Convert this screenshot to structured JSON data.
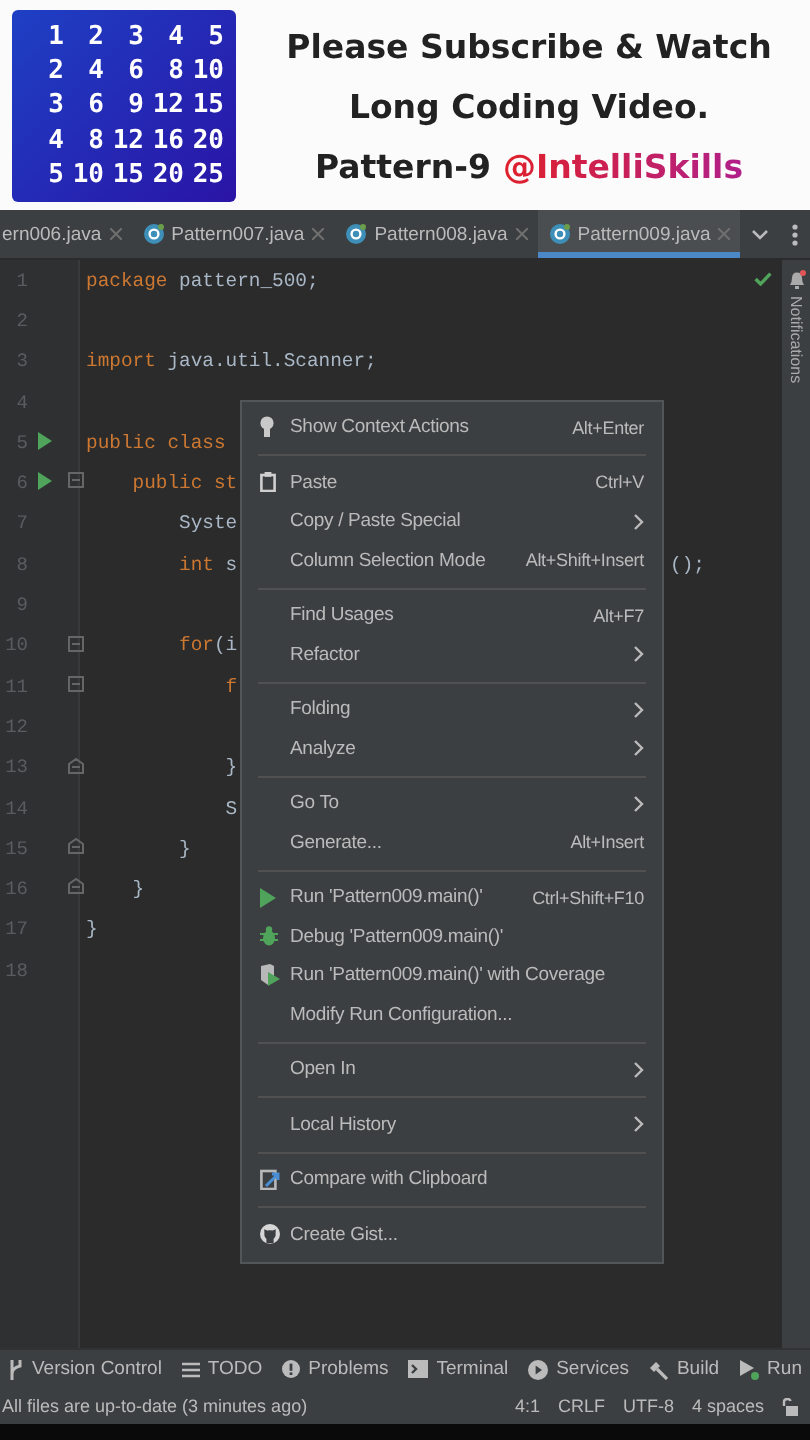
{
  "banner": {
    "number_grid": [
      [
        "1",
        "2",
        "3",
        "4",
        "5"
      ],
      [
        "2",
        "4",
        "6",
        "8",
        "10"
      ],
      [
        "3",
        "6",
        "9",
        "12",
        "15"
      ],
      [
        "4",
        "8",
        "12",
        "16",
        "20"
      ],
      [
        "5",
        "10",
        "15",
        "20",
        "25"
      ]
    ],
    "title_lines": [
      "Please Subscribe & Watch",
      "Long Coding Video."
    ],
    "pattern_label": "Pattern-9",
    "channel": "@IntelliSkills"
  },
  "tabs": [
    {
      "label": "ern006.java",
      "icon": false,
      "selected": false
    },
    {
      "label": "Pattern007.java",
      "icon": true,
      "selected": false
    },
    {
      "label": "Pattern008.java",
      "icon": true,
      "selected": false
    },
    {
      "label": "Pattern009.java",
      "icon": true,
      "selected": true
    }
  ],
  "notifications": {
    "label": "Notifications"
  },
  "code_lines": [
    {
      "number": "1",
      "run": false,
      "fold_start": false,
      "fold_end": false,
      "parts": [
        {
          "text": "package",
          "kind": "keyword"
        },
        {
          "text": " pattern_500;",
          "kind": "plain"
        }
      ]
    },
    {
      "number": "2",
      "run": false,
      "fold_start": false,
      "fold_end": false
    },
    {
      "number": "3",
      "run": false,
      "fold_start": false,
      "fold_end": false,
      "parts": [
        {
          "text": "import",
          "kind": "keyword"
        },
        {
          "text": " java.util.Scanner;",
          "kind": "plain"
        }
      ]
    },
    {
      "number": "4",
      "run": false,
      "fold_start": false,
      "fold_end": false
    },
    {
      "number": "5",
      "run": true,
      "fold_start": false,
      "fold_end": false,
      "parts": [
        {
          "text": "public class",
          "kind": "keyword"
        }
      ]
    },
    {
      "number": "6",
      "run": true,
      "fold_start": true,
      "fold_end": false,
      "parts": [
        {
          "text": "    public st",
          "kind": "keyword"
        }
      ]
    },
    {
      "number": "7",
      "run": false,
      "fold_start": false,
      "fold_end": false,
      "parts": [
        {
          "text": "        Syste",
          "kind": "plain"
        }
      ]
    },
    {
      "number": "8",
      "run": false,
      "fold_start": false,
      "fold_end": false,
      "parts": [
        {
          "text": "        int",
          "kind": "keyword"
        },
        {
          "text": " s",
          "kind": "plain"
        }
      ],
      "tail": "();"
    },
    {
      "number": "9",
      "run": false,
      "fold_start": false,
      "fold_end": false
    },
    {
      "number": "10",
      "run": false,
      "fold_start": true,
      "fold_end": false,
      "parts": [
        {
          "text": "        for",
          "kind": "keyword"
        },
        {
          "text": "(i",
          "kind": "plain"
        }
      ]
    },
    {
      "number": "11",
      "run": false,
      "fold_start": true,
      "fold_end": false,
      "parts": [
        {
          "text": "            f",
          "kind": "keyword"
        }
      ]
    },
    {
      "number": "12",
      "run": false,
      "fold_start": false,
      "fold_end": false
    },
    {
      "number": "13",
      "run": false,
      "fold_start": false,
      "fold_end": true,
      "parts": [
        {
          "text": "            }",
          "kind": "plain"
        }
      ]
    },
    {
      "number": "14",
      "run": false,
      "fold_start": false,
      "fold_end": false,
      "parts": [
        {
          "text": "            S",
          "kind": "plain"
        }
      ]
    },
    {
      "number": "15",
      "run": false,
      "fold_start": false,
      "fold_end": true,
      "parts": [
        {
          "text": "        }",
          "kind": "plain"
        }
      ]
    },
    {
      "number": "16",
      "run": false,
      "fold_start": false,
      "fold_end": true,
      "parts": [
        {
          "text": "    }",
          "kind": "plain"
        }
      ]
    },
    {
      "number": "17",
      "run": false,
      "fold_start": false,
      "fold_end": false,
      "parts": [
        {
          "text": "}",
          "kind": "plain"
        }
      ]
    },
    {
      "number": "18",
      "run": false,
      "fold_start": false,
      "fold_end": false
    }
  ],
  "context_menu": {
    "groups": [
      [
        {
          "label": "Show Context Actions",
          "shortcut": "Alt+Enter",
          "submenu": false
        }
      ],
      [
        {
          "label": "Paste",
          "shortcut": "Ctrl+V",
          "submenu": false
        },
        {
          "label": "Copy / Paste Special",
          "submenu": true
        },
        {
          "label": "Column Selection Mode",
          "shortcut": "Alt+Shift+Insert",
          "submenu": false
        }
      ],
      [
        {
          "label": "Find Usages",
          "shortcut": "Alt+F7",
          "submenu": false
        },
        {
          "label": "Refactor",
          "submenu": true
        }
      ],
      [
        {
          "label": "Folding",
          "submenu": true
        },
        {
          "label": "Analyze",
          "submenu": true
        }
      ],
      [
        {
          "label": "Go To",
          "submenu": true
        },
        {
          "label": "Generate...",
          "shortcut": "Alt+Insert",
          "submenu": false
        }
      ],
      [
        {
          "label": "Run 'Pattern009.main()'",
          "shortcut": "Ctrl+Shift+F10",
          "submenu": false
        },
        {
          "label": "Debug 'Pattern009.main()'",
          "submenu": false
        },
        {
          "label": "Run 'Pattern009.main()' with Coverage",
          "submenu": false
        },
        {
          "label": "Modify Run Configuration...",
          "submenu": false
        }
      ],
      [
        {
          "label": "Open In",
          "submenu": true
        }
      ],
      [
        {
          "label": "Local History",
          "submenu": true
        }
      ],
      [
        {
          "label": "Compare with Clipboard",
          "submenu": false
        }
      ],
      [
        {
          "label": "Create Gist...",
          "submenu": false
        }
      ]
    ]
  },
  "tool_windows": [
    {
      "label": "Version Control"
    },
    {
      "label": "TODO"
    },
    {
      "label": "Problems"
    },
    {
      "label": "Terminal"
    },
    {
      "label": "Services"
    },
    {
      "label": "Build"
    },
    {
      "label": "Run"
    }
  ],
  "status_bar": {
    "message": "All files are up-to-date (3 minutes ago)",
    "items": [
      "4:1",
      "CRLF",
      "UTF-8",
      "4 spaces"
    ]
  }
}
